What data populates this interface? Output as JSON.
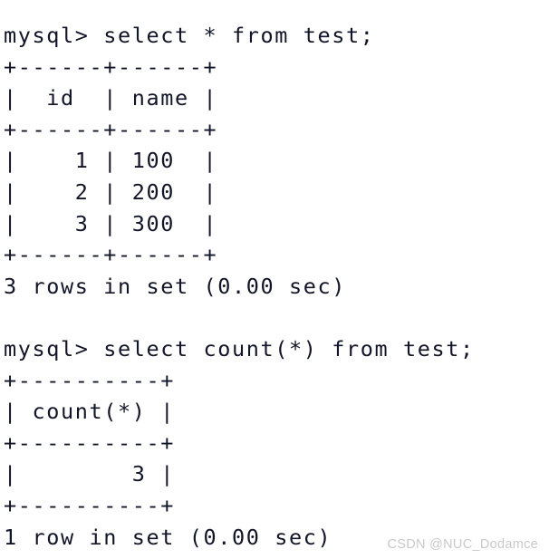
{
  "terminal": {
    "prompt": "mysql>",
    "background_color": "#ffffff",
    "text_color": "#121428",
    "lines": [
      {
        "id": "query-1-command",
        "kind": "command",
        "text": "mysql> select * from test;"
      },
      {
        "id": "table-1-border-top",
        "kind": "border",
        "text": "+------+------+"
      },
      {
        "id": "table-1-header",
        "kind": "header",
        "text": "|  id  | name |"
      },
      {
        "id": "table-1-border-mid",
        "kind": "border",
        "text": "+------+------+"
      },
      {
        "id": "table-1-row-1",
        "kind": "row",
        "text": "|    1 | 100  |"
      },
      {
        "id": "table-1-row-2",
        "kind": "row",
        "text": "|    2 | 200  |"
      },
      {
        "id": "table-1-row-3",
        "kind": "row",
        "text": "|    3 | 300  |"
      },
      {
        "id": "table-1-border-bottom",
        "kind": "border",
        "text": "+------+------+"
      },
      {
        "id": "query-1-status",
        "kind": "status",
        "text": "3 rows in set (0.00 sec)"
      },
      {
        "id": "spacer-1",
        "kind": "blank",
        "text": ""
      },
      {
        "id": "query-2-command",
        "kind": "command",
        "text": "mysql> select count(*) from test;"
      },
      {
        "id": "table-2-border-top",
        "kind": "border",
        "text": "+----------+"
      },
      {
        "id": "table-2-header",
        "kind": "header",
        "text": "| count(*) |"
      },
      {
        "id": "table-2-border-mid",
        "kind": "border",
        "text": "+----------+"
      },
      {
        "id": "table-2-row-1",
        "kind": "row",
        "text": "|        3 |"
      },
      {
        "id": "table-2-border-bottom",
        "kind": "border",
        "text": "+----------+"
      },
      {
        "id": "query-2-status",
        "kind": "status",
        "text": "1 row in set (0.00 sec)"
      }
    ]
  },
  "queries": [
    {
      "sql": "select * from test;",
      "result_table": {
        "columns": [
          "id",
          "name"
        ],
        "rows": [
          [
            "1",
            "100"
          ],
          [
            "2",
            "200"
          ],
          [
            "3",
            "300"
          ]
        ]
      },
      "status": "3 rows in set (0.00 sec)",
      "row_count": 3,
      "elapsed": "0.00 sec"
    },
    {
      "sql": "select count(*) from test;",
      "result_table": {
        "columns": [
          "count(*)"
        ],
        "rows": [
          [
            "3"
          ]
        ]
      },
      "status": "1 row in set (0.00 sec)",
      "row_count": 1,
      "elapsed": "0.00 sec"
    }
  ],
  "watermark": {
    "text": "CSDN @NUC_Dodamce",
    "color": "#c9c9c9"
  }
}
